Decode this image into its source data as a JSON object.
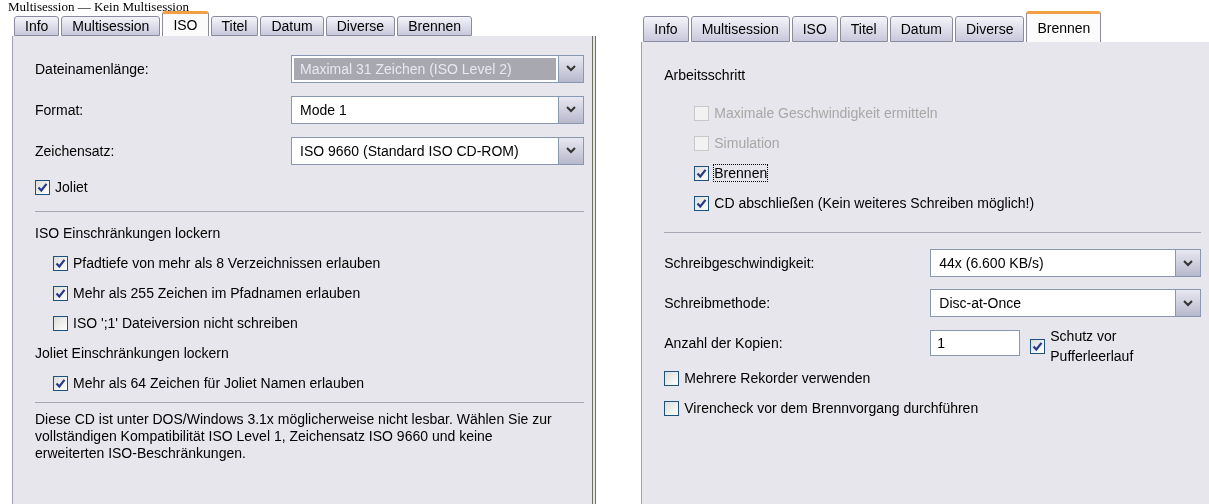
{
  "caption": "Multisession — Kein Multisession",
  "left_panel": {
    "tabs": [
      {
        "label": "Info",
        "selected": false
      },
      {
        "label": "Multisession",
        "selected": false
      },
      {
        "label": "ISO",
        "selected": true
      },
      {
        "label": "Titel",
        "selected": false
      },
      {
        "label": "Datum",
        "selected": false
      },
      {
        "label": "Diverse",
        "selected": false
      },
      {
        "label": "Brennen",
        "selected": false
      }
    ],
    "fields": [
      {
        "label": "Dateinamenlänge:",
        "value": "Maximal 31 Zeichen (ISO Level 2)",
        "disabled": true
      },
      {
        "label": "Format:",
        "value": "Mode 1",
        "disabled": false
      },
      {
        "label": "Zeichensatz:",
        "value": "ISO 9660 (Standard ISO CD-ROM)",
        "disabled": false
      }
    ],
    "joliet": {
      "label": "Joliet",
      "checked": true
    },
    "groups": [
      {
        "heading": "ISO Einschränkungen lockern",
        "options": [
          {
            "label": "Pfadtiefe von mehr als 8 Verzeichnissen erlauben",
            "checked": true
          },
          {
            "label": "Mehr als 255 Zeichen im Pfadnamen erlauben",
            "checked": true
          },
          {
            "label": "ISO ';1' Dateiversion nicht schreiben",
            "checked": false
          }
        ]
      },
      {
        "heading": "Joliet Einschränkungen lockern",
        "options": [
          {
            "label": "Mehr als 64 Zeichen für Joliet Namen erlauben",
            "checked": true
          }
        ]
      }
    ],
    "note": "Diese CD ist unter DOS/Windows 3.1x möglicherweise nicht lesbar. Wählen Sie zur vollständigen Kompatibilität ISO Level 1, Zeichensatz ISO 9660 und keine erweiterten ISO-Beschränkungen."
  },
  "right_panel": {
    "tabs": [
      {
        "label": "Info",
        "selected": false
      },
      {
        "label": "Multisession",
        "selected": false
      },
      {
        "label": "ISO",
        "selected": false
      },
      {
        "label": "Titel",
        "selected": false
      },
      {
        "label": "Datum",
        "selected": false
      },
      {
        "label": "Diverse",
        "selected": false
      },
      {
        "label": "Brennen",
        "selected": true
      }
    ],
    "heading": "Arbeitsschritt",
    "steps": [
      {
        "label": "Maximale Geschwindigkeit ermitteln",
        "checked": false,
        "disabled": true,
        "focused": false
      },
      {
        "label": "Simulation",
        "checked": false,
        "disabled": true,
        "focused": false
      },
      {
        "label": "Brennen",
        "checked": true,
        "disabled": false,
        "focused": true
      },
      {
        "label": "CD abschließen (Kein weiteres Schreiben möglich!)",
        "checked": true,
        "disabled": false,
        "focused": false
      }
    ],
    "fields": [
      {
        "label": "Schreibgeschwindigkeit:",
        "value": "44x (6.600 KB/s)"
      },
      {
        "label": "Schreibmethode:",
        "value": "Disc-at-Once"
      }
    ],
    "copies": {
      "label": "Anzahl der Kopien:",
      "value": "1"
    },
    "buffer": {
      "label": "Schutz vor Pufferleerlauf",
      "checked": true
    },
    "options": [
      {
        "label": "Mehrere Rekorder verwenden",
        "checked": false
      },
      {
        "label": "Virencheck vor dem Brennvorgang durchführen",
        "checked": false
      }
    ]
  }
}
